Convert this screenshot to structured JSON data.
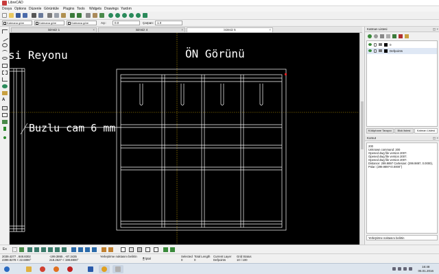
{
  "window": {
    "title": "LibreCAD"
  },
  "menu": [
    "Dosya",
    "Options",
    "Düzenle",
    "Görüntüle",
    "Plugins",
    "Tools",
    "Widgets",
    "Drawings",
    "Yardım"
  ],
  "toolbar_icons": [
    "new-icon",
    "open-icon",
    "save-icon",
    "save-as-icon",
    "print-icon",
    "print-preview-icon",
    "cut-icon",
    "copy-icon",
    "paste-icon",
    "undo-icon",
    "redo-icon",
    "grid-icon",
    "draft-icon",
    "redraw-icon",
    "zoom-in-icon",
    "zoom-out-icon",
    "zoom-auto-icon",
    "zoom-previous-icon",
    "zoom-window-icon",
    "zoom-pan-icon"
  ],
  "pen_toolbar": {
    "color": "Katmana göre",
    "width": "Katmana göre",
    "linetype": "Katmana göre",
    "angle_label": "Açı:",
    "angle_value": "0.0",
    "scale_label": "Çarpan:",
    "scale_value": "1.0"
  },
  "tabs": [
    {
      "label": "isimsiz 1",
      "active": false
    },
    {
      "label": "isimsiz 4",
      "active": false
    },
    {
      "label": "isimsiz 5",
      "active": true
    }
  ],
  "canvas": {
    "texts": {
      "reyonu": "si Reyonu",
      "on_gorunus": "ÖN Görünü",
      "buzlu_cam": "Buzlu cam 6 mm"
    },
    "colors": {
      "background": "#000000",
      "lines": "#ffffff",
      "crosshair": "#c8a000"
    }
  },
  "right_panel": {
    "layer_title": "Katman Listesi",
    "layers": [
      {
        "name": "0",
        "color": "#000000"
      },
      {
        "name": "Defpoints",
        "color": "#000000"
      }
    ],
    "panel_tabs": [
      "Kütüphane Tarayıcı",
      "Blok listesi",
      "Katman Listesi"
    ],
    "command_title": "Komut",
    "command_output": [
      "200",
      "Unknown command: 200",
      "Opened dwg file version 2007.",
      "Opened dwg file version 2007.",
      "Opened dwg file version 2007.",
      "Distance: 299.9897 Cartesian: (299.9897, 0.0000),",
      "Polar: (299.9897<0.0000°)"
    ],
    "command_prompt": "Yerleştirme noktasını belirtin"
  },
  "snap_bar": {
    "prefix": "Ex"
  },
  "status": {
    "abs_coords_1": "2039.4277 , 848.8302",
    "abs_coords_2": "2399.8278 < 22.6890°",
    "rel_coords_1": "-199.3865 , -87.3435",
    "rel_coords_2": "218.2627 < 198.8800°",
    "prompt_label": "Yerleştirme noktasını belirtin",
    "cancel_label": "İptal",
    "selected_label": "Selected",
    "selected_value": "0",
    "total_length_label": "Total Length",
    "total_length_value": "0",
    "current_layer_label": "Current Layer",
    "current_layer_value": "Defpoints",
    "grid_status_label": "Grid Status",
    "grid_status_value": "10 / 100"
  },
  "taskbar": {
    "apps": [
      "start-icon",
      "explorer-icon",
      "chrome-icon",
      "firefox-icon",
      "opera-icon",
      "word-icon",
      "media-player-icon",
      "librecad-icon"
    ],
    "time": "16:48",
    "date": "05.01.2016"
  }
}
